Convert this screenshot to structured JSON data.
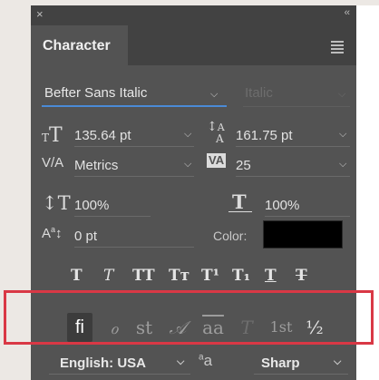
{
  "titlebar": {
    "close_glyph": "×",
    "collapse_glyph": "‹‹"
  },
  "panel": {
    "tab_label": "Character"
  },
  "font": {
    "family": "Befter Sans Italic",
    "style": "Italic"
  },
  "metrics": {
    "size": "135.64 pt",
    "leading": "161.75 pt",
    "kerning": "Metrics",
    "tracking": "25",
    "vertical_scale": "100%",
    "horizontal_scale": "100%",
    "baseline_shift": "0 pt",
    "color_label": "Color:",
    "color_value": "#000000"
  },
  "type_styles": [
    {
      "name": "faux-bold",
      "glyph": "T"
    },
    {
      "name": "faux-italic",
      "glyph": "T"
    },
    {
      "name": "all-caps",
      "glyph": "TT"
    },
    {
      "name": "small-caps",
      "glyph": "Tт"
    },
    {
      "name": "superscript",
      "glyph": "T¹"
    },
    {
      "name": "subscript",
      "glyph": "T₁"
    },
    {
      "name": "underline",
      "glyph": "T"
    },
    {
      "name": "strikethrough",
      "glyph": "T"
    }
  ],
  "opentype": [
    {
      "name": "standard-ligatures",
      "glyph": "fi",
      "active": true
    },
    {
      "name": "contextual-alternates",
      "glyph": "ℴ"
    },
    {
      "name": "discretionary-ligatures",
      "glyph": "st"
    },
    {
      "name": "swash",
      "glyph": "𝒜"
    },
    {
      "name": "stylistic-alternates",
      "glyph": "aa"
    },
    {
      "name": "titling-alternates",
      "glyph": "T"
    },
    {
      "name": "ordinals",
      "glyph": "1st"
    },
    {
      "name": "fractions",
      "glyph": "½"
    }
  ],
  "language": "English: USA",
  "antialias": {
    "label": "a",
    "sup": "a",
    "method": "Sharp"
  },
  "colors": {
    "panel": "#535353",
    "header": "#424242",
    "accent": "#4a8ad6",
    "highlight": "#d93845"
  }
}
